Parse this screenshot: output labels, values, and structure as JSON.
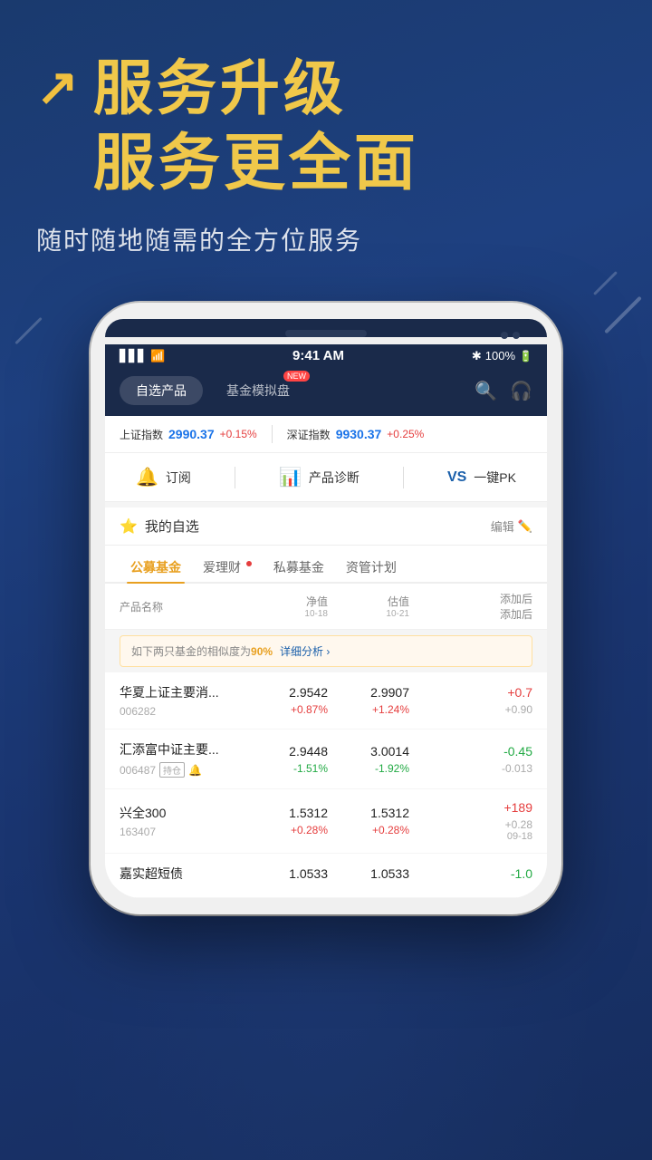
{
  "hero": {
    "icon": "↗",
    "title_line1": "服务升级",
    "title_line2": "服务更全面",
    "subtitle": "随时随地随需的全方位服务"
  },
  "status_bar": {
    "time": "9:41 AM",
    "signal": "▋▋▋",
    "wifi": "WiFi",
    "bluetooth": "Bluetooth",
    "battery": "100%"
  },
  "nav": {
    "tab1": "自选产品",
    "tab2": "基金模拟盘",
    "tab2_badge": "NEW",
    "search_icon": "search",
    "headphone_icon": "headphone"
  },
  "ticker": {
    "label1": "上证指数",
    "value1": "2990.37",
    "change1": "+0.15%",
    "label2": "深证指数",
    "value2": "9930.37",
    "change2": "+0.25%"
  },
  "actions": {
    "item1_icon": "bell",
    "item1_label": "订阅",
    "item2_icon": "chart",
    "item2_label": "产品诊断",
    "item3_icon": "vs",
    "item3_label": "一键PK"
  },
  "watchlist": {
    "title": "我的自选",
    "edit": "编辑"
  },
  "fund_tabs": {
    "tab1": "公募基金",
    "tab2": "爱理财",
    "tab2_dot": true,
    "tab3": "私募基金",
    "tab4": "资管计划"
  },
  "table_header": {
    "col1": "产品名称",
    "col2": "净值",
    "col2_date": "10-18",
    "col3": "估值",
    "col3_date": "10-21",
    "col4_line1": "添加后",
    "col4_line2": "添加后"
  },
  "similarity_alert": {
    "text1": "如下两只基金的相似度为",
    "pct": "90%",
    "link": "详细分析 ›"
  },
  "funds": [
    {
      "name": "华夏上证主要消...",
      "code": "006282",
      "badge": "",
      "bell": false,
      "nav_val": "2.9542",
      "nav_chg": "+0.87%",
      "nav_up": true,
      "est_val": "2.9907",
      "est_chg": "+1.24%",
      "est_up": true,
      "right_val": "+0.7",
      "right_sub": "+0.90",
      "right_up": true
    },
    {
      "name": "汇添富中证主要...",
      "code": "006487",
      "badge": "持仓",
      "bell": true,
      "nav_val": "2.9448",
      "nav_chg": "-1.51%",
      "nav_up": false,
      "est_val": "3.0014",
      "est_chg": "-1.92%",
      "est_up": false,
      "right_val": "-0.45",
      "right_sub": "-0.013",
      "right_up": false
    },
    {
      "name": "兴全300",
      "code": "163407",
      "badge": "",
      "bell": false,
      "nav_val": "1.5312",
      "nav_chg": "+0.28%",
      "nav_up": true,
      "est_val": "1.5312",
      "est_chg": "+0.28%",
      "est_up": true,
      "right_val": "+189",
      "right_sub": "+0.28",
      "right_extra": "09-18",
      "right_up": true
    },
    {
      "name": "嘉实超短债",
      "code": "",
      "badge": "",
      "bell": false,
      "nav_val": "1.0533",
      "nav_chg": "",
      "est_val": "1.0533",
      "est_chg": "",
      "right_val": "-1.0",
      "right_sub": "",
      "right_up": false
    }
  ]
}
